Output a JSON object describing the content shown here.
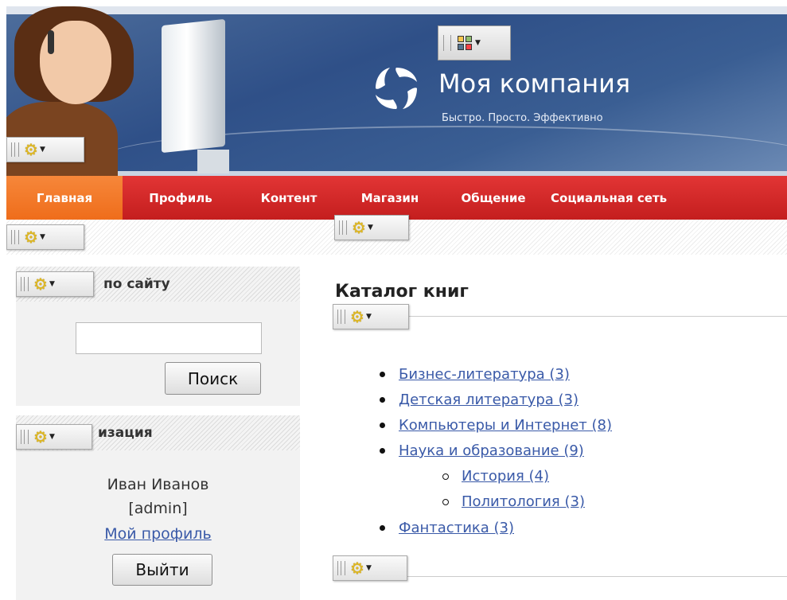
{
  "header": {
    "brand_title": "Моя компания",
    "brand_slogan": "Быстро. Просто. Эффективно"
  },
  "nav": {
    "items": [
      {
        "label": "Главная",
        "active": true
      },
      {
        "label": "Профиль",
        "active": false
      },
      {
        "label": "Контент",
        "active": false
      },
      {
        "label": "Магазин",
        "active": false
      },
      {
        "label": "Общение",
        "active": false
      },
      {
        "label": "Социальная сеть",
        "active": false
      }
    ]
  },
  "sidebar": {
    "search": {
      "header": "Поиск по сайту",
      "visible_header_text": "по сайту",
      "input_value": "",
      "button_label": "Поиск"
    },
    "auth": {
      "header": "Авторизация",
      "visible_header_text": "изация",
      "user_name": "Иван Иванов",
      "user_login": "[admin]",
      "profile_link": "Мой профиль",
      "logout_button": "Выйти"
    }
  },
  "main": {
    "title": "Каталог книг",
    "categories": [
      {
        "label": "Бизнес-литература (3)",
        "level": 0
      },
      {
        "label": "Детская литература (3)",
        "level": 0
      },
      {
        "label": "Компьютеры и Интернет (8)",
        "level": 0
      },
      {
        "label": "Наука и образование (9)",
        "level": 0
      },
      {
        "label": "История (4)",
        "level": 1
      },
      {
        "label": "Политология (3)",
        "level": 1
      },
      {
        "label": "Фантастика (3)",
        "level": 0
      }
    ]
  },
  "icons": {
    "gear": "gear-icon",
    "grid": "grid-icon",
    "grip": "drag-handle-icon",
    "caret": "chevron-down-icon"
  },
  "colors": {
    "nav_bg": "#d42a2a",
    "nav_active": "#f37a28",
    "link": "#3a5aa8",
    "header_bg": "#3a5a90"
  }
}
